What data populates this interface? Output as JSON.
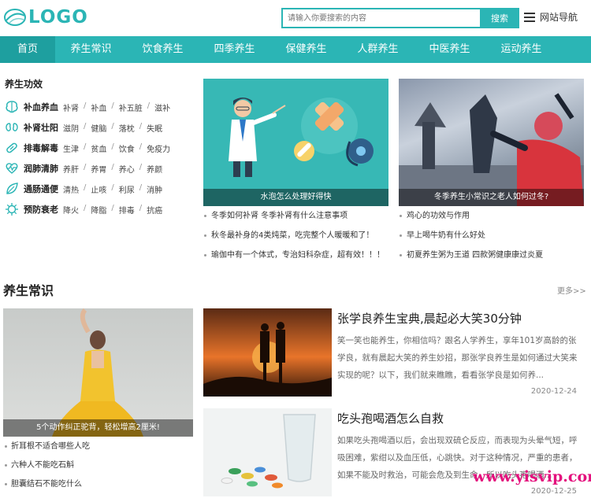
{
  "header": {
    "logo_text": "LOGO",
    "search_placeholder": "请输入你要搜索的内容",
    "search_button": "搜索",
    "site_nav": "网站导航"
  },
  "nav": [
    "首页",
    "养生常识",
    "饮食养生",
    "四季养生",
    "保健养生",
    "人群养生",
    "中医养生",
    "运动养生"
  ],
  "effects": {
    "title": "养生功效",
    "rows": [
      {
        "icon": "brain-icon",
        "name": "补血养血",
        "tags": [
          "补肾",
          "补血",
          "补五脏",
          "滋补"
        ]
      },
      {
        "icon": "kidney-icon",
        "name": "补肾壮阳",
        "tags": [
          "滋阴",
          "健脑",
          "落枕",
          "失眠"
        ]
      },
      {
        "icon": "capsule-icon",
        "name": "排毒解毒",
        "tags": [
          "生津",
          "贫血",
          "饮食",
          "免疫力"
        ]
      },
      {
        "icon": "heartbeat-icon",
        "name": "润肺清肺",
        "tags": [
          "养肝",
          "养胃",
          "养心",
          "养颜"
        ]
      },
      {
        "icon": "leaf-icon",
        "name": "通肠通便",
        "tags": [
          "清热",
          "止咳",
          "利尿",
          "消肿"
        ]
      },
      {
        "icon": "virus-icon",
        "name": "预防衰老",
        "tags": [
          "降火",
          "降脂",
          "排毒",
          "抗癌"
        ]
      }
    ]
  },
  "promo1": {
    "caption": "水泡怎么处理好得快",
    "list": [
      "冬季如何补肾 冬季补肾有什么注意事项",
      "秋冬最补身的4类炖菜，吃完整个人暖暖和了！",
      "瑜伽中有一个体式，专治妇科杂症，超有效！！！"
    ]
  },
  "promo2": {
    "caption": "冬季养生小常识之老人如何过冬?",
    "list": [
      "鸡心的功效与作用",
      "早上喝牛奶有什么好处",
      "初夏养生粥为王道 四款粥健康康过炎夏"
    ]
  },
  "section": {
    "title": "养生常识",
    "more": "更多>>",
    "big_caption": "5个动作纠正驼背，轻松增高2厘米!",
    "side_list": [
      "折耳根不适合哪些人吃",
      "六种人不能吃石斛",
      "胆囊结石不能吃什么"
    ],
    "articles": [
      {
        "title": "张学良养生宝典,晨起必大笑30分钟",
        "desc": "笑一笑也能养生，你相信吗？跟名人学养生，享年101岁高龄的张学良，就有晨起大笑的养生妙招，那张学良养生是如何通过大笑来实现的呢？以下，我们就来瞧瞧，看看张学良是如何养...",
        "date": "2020-12-24"
      },
      {
        "title": "吃头孢喝酒怎么自救",
        "desc": "如果吃头孢喝酒以后，会出现双硫仑反应，而表现为头晕气短，呼吸困难，紫绀以及血压低，心跳快。对于这种情况，严重的患者，如果不能及时救治，可能会危及到生命。所以吃头孢喝酒...",
        "date": "2020-12-25"
      }
    ]
  },
  "watermark": "www.yisvip.com",
  "colors": {
    "accent": "#2bb5b5",
    "nav_active": "#1e9f9f",
    "watermark": "#e4107d"
  }
}
